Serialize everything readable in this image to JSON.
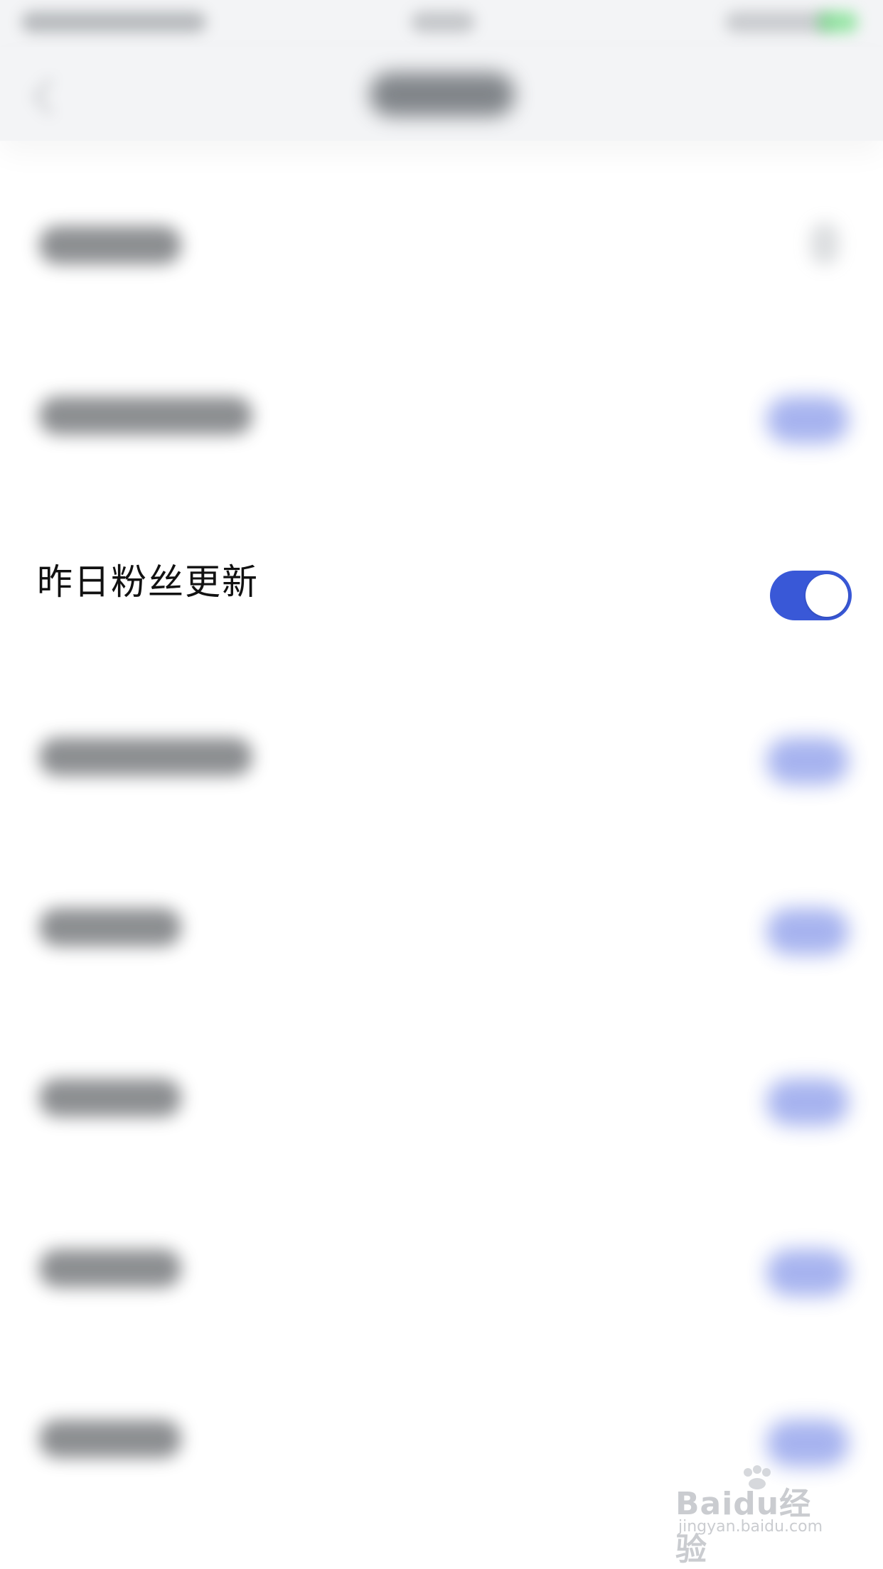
{
  "focus_row": {
    "label": "昨日粉丝更新",
    "toggle_on": true
  },
  "colors": {
    "accent": "#3958d7",
    "toggle_knob": "#ffffff",
    "background": "#ffffff",
    "nav_background": "#f3f4f6"
  },
  "watermark": {
    "logo": "Baidu经验",
    "url": "jingyan.baidu.com"
  }
}
